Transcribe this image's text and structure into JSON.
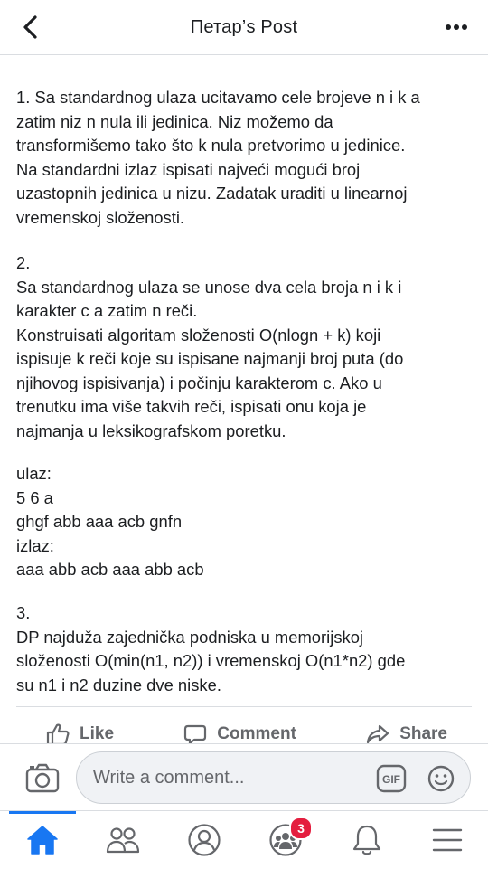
{
  "header": {
    "title": "Петар’s Post"
  },
  "post": {
    "paragraphs": [
      "1. Sa standardnog ulaza ucitavamo cele brojeve n i k a\nzatim niz n nula ili jedinica. Niz možemo da\ntransformišemo tako što k nula pretvorimo u jedinice.\nNa standardni izlaz ispisati najveći mogući broj\nuzastopnih jedinica u nizu. Zadatak uraditi u linearnoj\nvremenskoj složenosti.",
      "2.\nSa standardnog ulaza se unose dva cela broja n i k i\nkarakter c a zatim n reči.\nKonstruisati algoritam složenosti O(nlogn + k) koji\nispisuje k reči koje su ispisane najmanji broj puta (do\nnjihovog ispisivanja) i počinju karakterom c. Ako u\ntrenutku ima više takvih reči, ispisati onu koja je\nnajmanja u leksikografskom poretku.",
      "ulaz:\n5 6 a\nghgf abb aaa acb gnfn\nizlaz:\naaa abb acb aaa abb acb",
      "3.\nDP najduža zajednička podniska u memorijskoj\nsloženosti O(min(n1, n2)) i vremenskoj O(n1*n2) gde\nsu n1 i n2 duzine dve niske."
    ]
  },
  "actions": {
    "like": "Like",
    "comment": "Comment",
    "share": "Share"
  },
  "comment_bar": {
    "placeholder": "Write a comment...",
    "gif_label": "GIF"
  },
  "bottom_nav": {
    "groups_badge": "3"
  },
  "colors": {
    "accent": "#1877f2",
    "badge": "#e41e3f",
    "icon_gray": "#65676b"
  }
}
